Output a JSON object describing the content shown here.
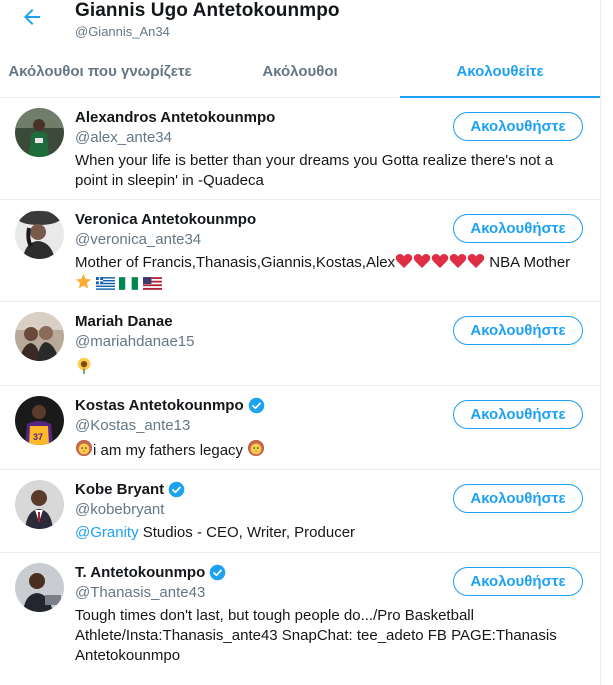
{
  "header": {
    "back_icon": "arrow-left-icon",
    "title": "Giannis Ugo Antetokounmpo",
    "handle": "@Giannis_An34"
  },
  "tabs": [
    {
      "label": "Ακόλουθοι που γνωρίζετε",
      "active": false
    },
    {
      "label": "Ακόλουθοι",
      "active": false
    },
    {
      "label": "Ακολουθείτε",
      "active": true
    }
  ],
  "colors": {
    "accent": "#1da1f2",
    "text": "#14171a",
    "muted": "#657786",
    "divider": "#e6ecf0"
  },
  "users": [
    {
      "name": "Alexandros Antetokounmpo",
      "handle": "@alex_ante34",
      "verified": false,
      "follow_label": "Ακολουθήστε",
      "bio": "When your life is better than your dreams you Gotta realize there's not a point in sleepin' in -Quadeca"
    },
    {
      "name": "Veronica Antetokounmpo",
      "handle": "@veronica_ante34",
      "verified": false,
      "follow_label": "Ακολουθήστε",
      "bio_text": "Mother of Francis,Thanasis,Giannis,Kostas,Alex",
      "bio_suffix": " NBA Mother",
      "bio_emojis": [
        "red-heart",
        "red-heart",
        "red-heart",
        "red-heart",
        "red-heart",
        "star",
        "flag-greece",
        "flag-nigeria",
        "flag-usa"
      ]
    },
    {
      "name": "Mariah Danae",
      "handle": "@mariahdanae15",
      "verified": false,
      "follow_label": "Ακολουθήστε",
      "bio_emojis": [
        "sunflower"
      ]
    },
    {
      "name": "Kostas Antetokounmpo",
      "handle": "@Kostas_ante13",
      "verified": true,
      "follow_label": "Ακολουθήστε",
      "bio_text": "i am my fathers legacy ",
      "bio_emojis": [
        "lion-face",
        "lion-face"
      ]
    },
    {
      "name": "Kobe Bryant",
      "handle": "@kobebryant",
      "verified": true,
      "follow_label": "Ακολουθήστε",
      "bio_mention": "@Granity",
      "bio_text": " Studios - CEO, Writer, Producer"
    },
    {
      "name": "T. Antetokounmpo",
      "handle": "@Thanasis_ante43",
      "verified": true,
      "follow_label": "Ακολουθήστε",
      "bio": "Tough times don't last, but tough people do.../Pro Basketball Athlete/Insta:Thanasis_ante43 SnapChat: tee_adeto FB PAGE:Thanasis Antetokounmpo"
    }
  ]
}
